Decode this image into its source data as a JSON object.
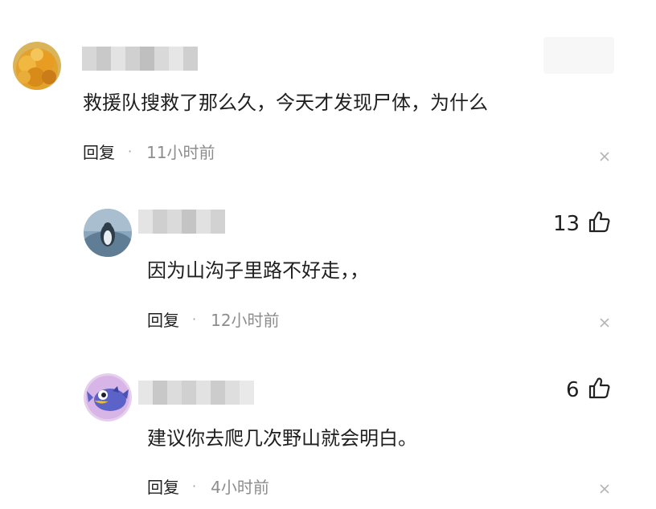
{
  "comments": [
    {
      "text": "救援队搜救了那么久，今天才发现尸体，为什么",
      "reply_label": "回复",
      "separator": "·",
      "time": "11小时前",
      "close_icon": "close-icon"
    },
    {
      "text": "因为山沟子里路不好走，，",
      "reply_label": "回复",
      "separator": "·",
      "time": "12小时前",
      "likes": "13",
      "like_icon": "thumbs-up-icon",
      "close_icon": "close-icon"
    },
    {
      "text": "建议你去爬几次野山就会明白。",
      "reply_label": "回复",
      "separator": "·",
      "time": "4小时前",
      "likes": "6",
      "like_icon": "thumbs-up-icon",
      "close_icon": "close-icon"
    }
  ]
}
